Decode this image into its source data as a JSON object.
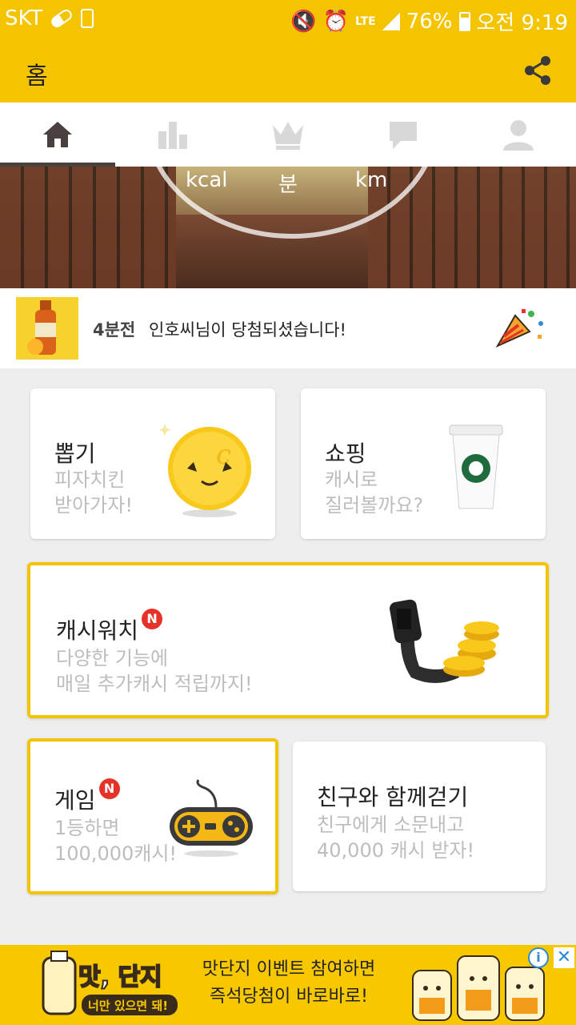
{
  "status_bar": {
    "carrier": "SKT",
    "lte": "LTE",
    "battery": "76%",
    "time": "오전 9:19"
  },
  "app_bar": {
    "title": "홈",
    "share_icon": "share-icon"
  },
  "tabs": [
    {
      "icon": "home-icon",
      "active": true
    },
    {
      "icon": "bar-chart-icon",
      "active": false
    },
    {
      "icon": "crown-icon",
      "active": false
    },
    {
      "icon": "chat-icon",
      "active": false
    },
    {
      "icon": "user-icon",
      "active": false
    }
  ],
  "banner": {
    "units": [
      "kcal",
      "분",
      "km"
    ]
  },
  "ticker": {
    "time_ago": "4분전",
    "message": "인호씨님이 당첨되셨습니다!"
  },
  "cards": {
    "draw": {
      "title": "뽑기",
      "sub1": "피자치킨",
      "sub2": "받아가자!"
    },
    "shop": {
      "title": "쇼핑",
      "sub1": "캐시로",
      "sub2": "질러볼까요?"
    },
    "watch": {
      "title": "캐시워치",
      "badge": "N",
      "sub1": "다양한 기능에",
      "sub2": "매일 추가캐시 적립까지!"
    },
    "game": {
      "title": "게임",
      "badge": "N",
      "sub1": "1등하면",
      "sub2": "100,000캐시!"
    },
    "friends": {
      "title": "친구와 함께걷기",
      "sub1": "친구에게 소문내고",
      "sub2": "40,000 캐시 받자!"
    }
  },
  "ad": {
    "logo": "맛, 단지",
    "tagline": "너만 있으면 돼!",
    "line1": "맛단지 이벤트 참여하면",
    "line2": "즉석당첨이 바로바로!",
    "info": "i",
    "close": "✕"
  },
  "colors": {
    "brand_yellow": "#f5c400",
    "badge_red": "#e6332a",
    "tab_icon_active": "#4a4040",
    "tab_icon_inactive": "#d8d8d8"
  }
}
